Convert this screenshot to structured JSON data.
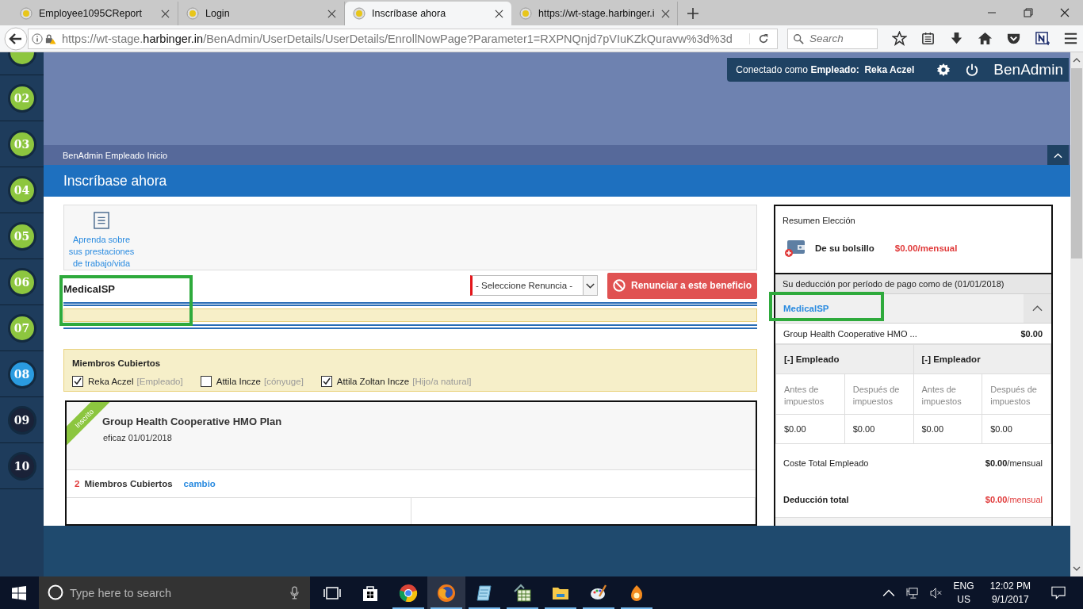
{
  "browser": {
    "tabs": [
      {
        "title": "Employee1095CReport",
        "selected": false
      },
      {
        "title": "Login",
        "selected": false
      },
      {
        "title": "Inscríbase ahora",
        "selected": true
      },
      {
        "title": "https://wt-stage.harbinger.i",
        "selected": false
      }
    ],
    "url": "https://wt-stage.**harbinger.in**/BenAdmin/UserDetails/UserDetails/EnrollNowPage?Parameter1=RXPNQnjd7pVIuKZkQuravw%3d%3d",
    "search": {
      "placeholder": "Search"
    }
  },
  "steps": [
    {
      "label": "02",
      "color": "#8dc63f"
    },
    {
      "label": "03",
      "color": "#8dc63f"
    },
    {
      "label": "04",
      "color": "#8dc63f"
    },
    {
      "label": "05",
      "color": "#8dc63f"
    },
    {
      "label": "06",
      "color": "#8dc63f"
    },
    {
      "label": "07",
      "color": "#8dc63f"
    },
    {
      "label": "08",
      "color": "#2a9be0"
    },
    {
      "label": "09",
      "color": "#1a2238"
    },
    {
      "label": "10",
      "color": "#1a2238"
    }
  ],
  "user_bar": {
    "prefix": "Conectado como",
    "role": "Empleado:",
    "name": "Reka Aczel",
    "brand": "BenAdmin"
  },
  "breadcrumb": "BenAdmin Empleado Inicio",
  "page_title": "Inscríbase ahora",
  "info_link": "Aprenda sobre sus prestaciones de trabajo/vida",
  "benefit": {
    "title": "MedicalSP",
    "waive_select": {
      "value": "- Seleccione Renuncia -"
    },
    "waive_button": "Renunciar a este beneficio"
  },
  "members": {
    "title": "Miembros Cubiertos",
    "items": [
      {
        "name": "Reka Aczel",
        "role": "[Empleado]",
        "checked": true
      },
      {
        "name": "Attila Incze",
        "role": "[cónyuge]",
        "checked": false
      },
      {
        "name": "Attila Zoltan Incze",
        "role": "[Hijo/a natural]",
        "checked": true
      }
    ]
  },
  "plan": {
    "ribbon": "Inscrito",
    "name": "Group Health Cooperative HMO Plan",
    "effective": "eficaz 01/01/2018",
    "member_count": "2",
    "members_label": "Miembros Cubiertos",
    "change_link": "cambio"
  },
  "summary": {
    "title": "Resumen Elección",
    "oop_label": "De su bolsillo",
    "oop_value": "$0.00/mensual",
    "deduction_header": "Su deducción por período de pago como de (01/01/2018)",
    "benefit": "MedicalSP",
    "expanded": true,
    "plan_name": "Group Health Cooperative HMO ...",
    "plan_amount": "$0.00",
    "groups": [
      "[-] Empleado",
      "[-] Empleador"
    ],
    "subheads": [
      "Antes de impuestos",
      "Después de impuestos",
      "Antes de impuestos",
      "Después de impuestos"
    ],
    "values": [
      "$0.00",
      "$0.00",
      "$0.00",
      "$0.00"
    ],
    "total_employee": {
      "label": "Coste Total Empleado",
      "amount": "$0.00",
      "unit": "/mensual"
    },
    "total_deduction": {
      "label": "Deducción total",
      "amount": "$0.00",
      "unit": "/mensual"
    }
  },
  "taskbar": {
    "search": {
      "placeholder": "Type here to search"
    },
    "apps": [
      {
        "kind": "taskview",
        "running": false,
        "selected": false
      },
      {
        "kind": "store",
        "running": false,
        "selected": false
      },
      {
        "kind": "chrome",
        "running": true,
        "selected": false
      },
      {
        "kind": "firefox",
        "running": true,
        "selected": true
      },
      {
        "kind": "notepad",
        "running": true,
        "selected": false
      },
      {
        "kind": "calculator",
        "running": true,
        "selected": false
      },
      {
        "kind": "folder",
        "running": true,
        "selected": false
      },
      {
        "kind": "paint",
        "running": true,
        "selected": false
      },
      {
        "kind": "flame",
        "running": true,
        "selected": false
      }
    ],
    "lang": "ENG",
    "region": "US",
    "time": "12:02 PM",
    "date": "9/1/2017"
  }
}
